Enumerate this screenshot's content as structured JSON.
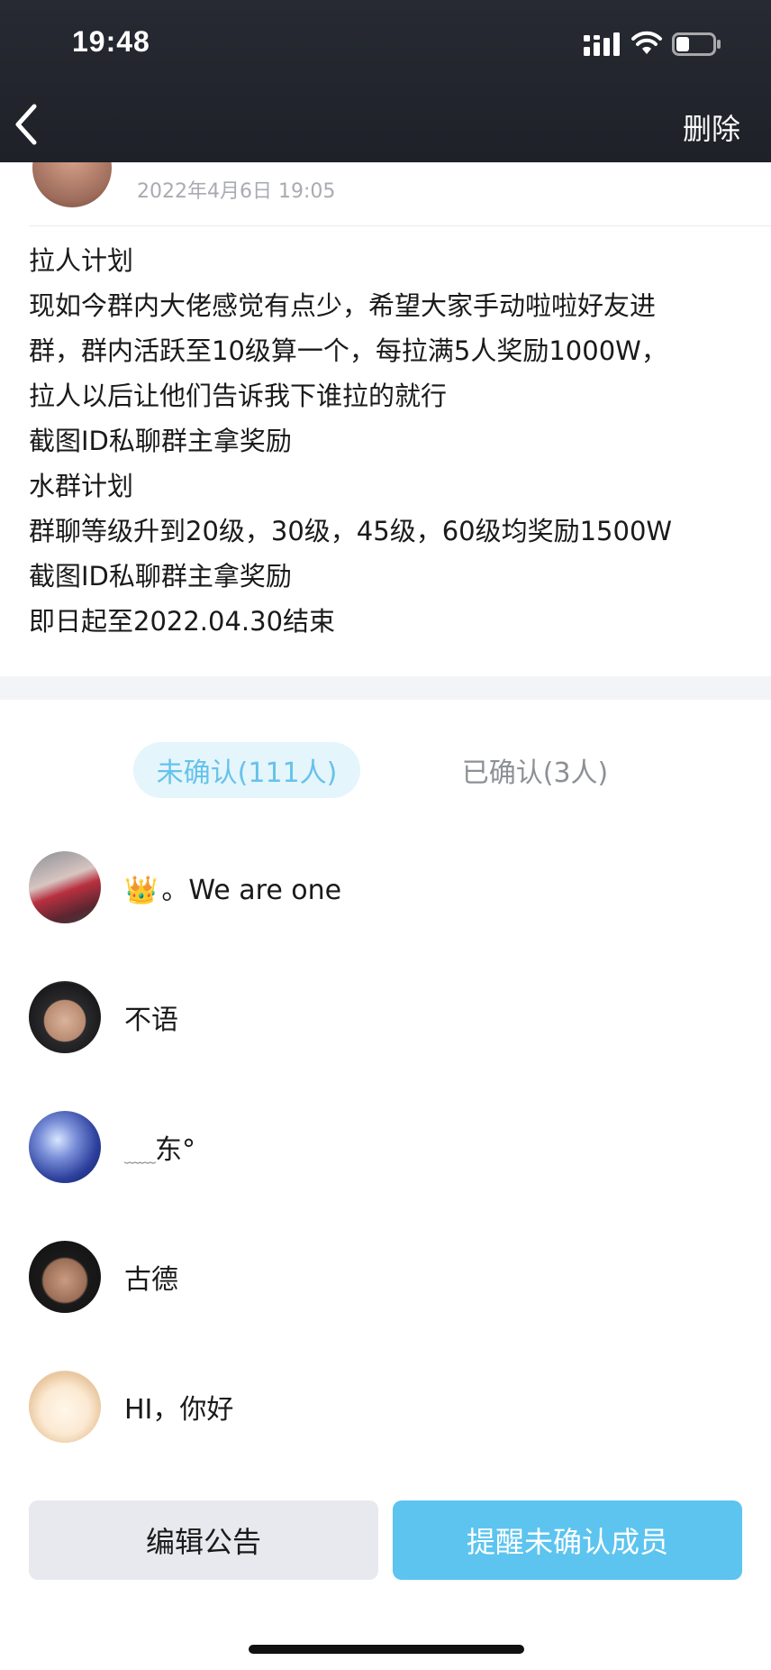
{
  "status_bar": {
    "time": "19:48"
  },
  "nav": {
    "delete_label": "删除"
  },
  "post": {
    "date": "2022年4月6日 19:05",
    "lines": [
      "拉人计划",
      "现如今群内大佬感觉有点少，希望大家手动啦啦好友进",
      "群，群内活跃至10级算一个，每拉满5人奖励1000W，",
      "拉人以后让他们告诉我下谁拉的就行",
      "截图ID私聊群主拿奖励",
      "水群计划",
      "群聊等级升到20级，30级，45级，60级均奖励1500W",
      "截图ID私聊群主拿奖励",
      "即日起至2022.04.30结束"
    ]
  },
  "tabs": {
    "unconfirmed": "未确认(111人)",
    "confirmed": "已确认(3人)"
  },
  "members": [
    {
      "name": "。We are one",
      "prefix_icon": "crown-icon"
    },
    {
      "name": "不语"
    },
    {
      "name": "东°",
      "prefix_text": "﹏﹏"
    },
    {
      "name": "古德"
    },
    {
      "name": "HI，你好"
    }
  ],
  "actions": {
    "edit": "编辑公告",
    "remind": "提醒未确认成员"
  },
  "colors": {
    "header_bg": "#23262d",
    "accent": "#5cc4ef",
    "tab_active_bg": "#e4f5fc",
    "tab_active_text": "#66c2ea"
  }
}
